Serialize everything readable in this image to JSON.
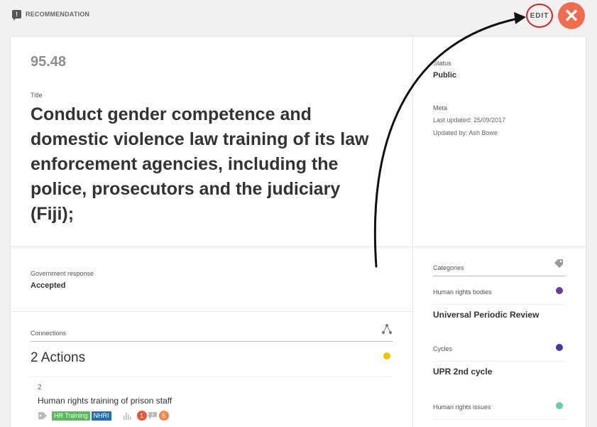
{
  "header": {
    "section_label": "RECOMMENDATION",
    "edit_label": "EDIT",
    "close_label": "✕"
  },
  "main": {
    "reference": "95.48",
    "title_label": "Title",
    "title": "Conduct gender competence and domestic violence law training of its law enforcement agencies, including the police, prosecutors and the judiciary (Fiji);",
    "government_response_label": "Government response",
    "government_response": "Accepted"
  },
  "side": {
    "status_label": "Status",
    "status": "Public",
    "meta_label": "Meta",
    "last_updated": "Last updated: 25/09/2017",
    "updated_by": "Updated by: Ash Bowe"
  },
  "connections": {
    "label": "Connections",
    "actions_title": "2 Actions",
    "actions_dot_color": "#f5c300",
    "items": [
      {
        "number": "2",
        "title": "Human rights training of prison staff",
        "tags": [
          {
            "label": "HR Training",
            "color": "#5cb85c"
          },
          {
            "label": "NHRI",
            "color": "#1f6fb5"
          }
        ],
        "counts": [
          {
            "value": "1",
            "color": "#e2583e"
          },
          {
            "value": "5",
            "color": "#f0884c"
          }
        ]
      }
    ]
  },
  "categories": {
    "label": "Categories",
    "groups": [
      {
        "label": "Human rights bodies",
        "value": "Universal Periodic Review",
        "color": "#6a3d9a"
      },
      {
        "label": "Cycles",
        "value": "UPR 2nd cycle",
        "color": "#3f3ba0"
      },
      {
        "label": "Human rights issues",
        "value": "",
        "color": "#66d19e"
      }
    ]
  },
  "icons": [
    "comment-icon",
    "close-icon",
    "network-icon",
    "tag-icon",
    "bar-chart-icon",
    "comment-bubble-icon"
  ]
}
